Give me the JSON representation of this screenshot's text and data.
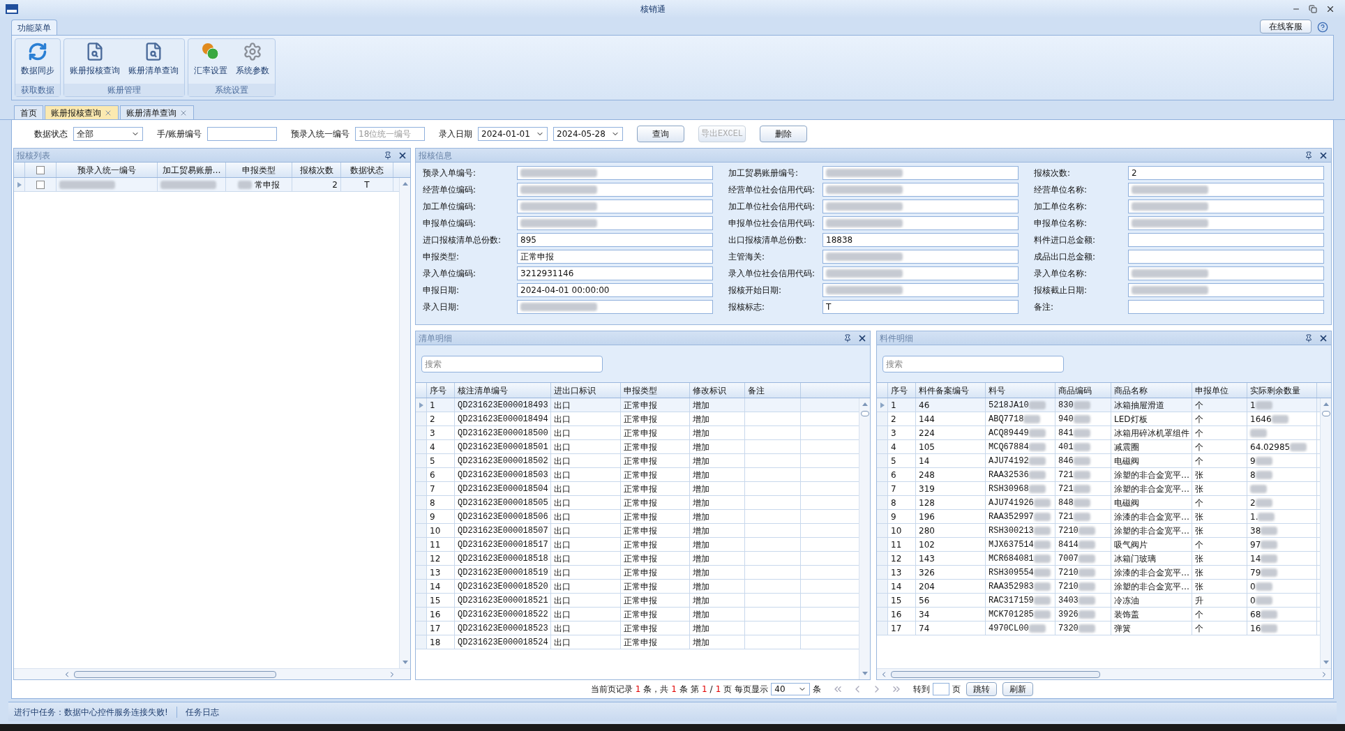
{
  "window": {
    "title": "核销通"
  },
  "ribbon": {
    "tab": "功能菜单",
    "help_button": "在线客服",
    "groups": [
      {
        "label": "获取数据",
        "buttons": [
          {
            "label": "数据同步"
          }
        ]
      },
      {
        "label": "账册管理",
        "buttons": [
          {
            "label": "账册报核查询"
          },
          {
            "label": "账册清单查询"
          }
        ]
      },
      {
        "label": "系统设置",
        "buttons": [
          {
            "label": "汇率设置"
          },
          {
            "label": "系统参数"
          }
        ]
      }
    ]
  },
  "doc_tabs": [
    {
      "label": "首页",
      "selected": false,
      "closable": false
    },
    {
      "label": "账册报核查询",
      "selected": true,
      "closable": true
    },
    {
      "label": "账册清单查询",
      "selected": false,
      "closable": true
    }
  ],
  "filters": [
    {
      "kind": "select",
      "label": "数据状态",
      "value": "全部"
    },
    {
      "kind": "input",
      "label": "手/账册编号"
    },
    {
      "kind": "input",
      "label": "预录入统一编号",
      "placeholder": "18位统一编号"
    },
    {
      "kind": "select",
      "label": "录入日期",
      "value": "2024-01-01"
    },
    {
      "kind": "select",
      "value": "2024-05-28"
    }
  ],
  "filter_buttons": [
    {
      "label": "查询",
      "disabled": false
    },
    {
      "label": "导出EXCEL",
      "disabled": true
    },
    {
      "label": "删除",
      "disabled": false
    }
  ],
  "list_panel": {
    "title": "报核列表",
    "all_checked": false,
    "columns": [
      "预录入统一编号",
      "加工贸易账册…",
      "申报类型",
      "报核次数",
      "数据状态"
    ],
    "rows": [
      {
        "current": true,
        "checked": false,
        "cells": [
          {
            "redacted": true
          },
          {
            "redacted": true
          },
          {
            "text": "常申报",
            "redacted": true
          },
          {
            "text": "2"
          },
          {
            "text": "T"
          }
        ]
      }
    ]
  },
  "info_panel": {
    "title": "报核信息",
    "fields": [
      {
        "label": "预录入单编号:",
        "redacted": true
      },
      {
        "label": "加工贸易账册编号:",
        "redacted": true
      },
      {
        "label": "报核次数:",
        "value": "2"
      },
      {
        "label": "经营单位编码:",
        "redacted": true
      },
      {
        "label": "经营单位社会信用代码:",
        "redacted": true
      },
      {
        "label": "经营单位名称:",
        "redacted": true
      },
      {
        "label": "加工单位编码:",
        "redacted": true
      },
      {
        "label": "加工单位社会信用代码:",
        "redacted": true
      },
      {
        "label": "加工单位名称:",
        "redacted": true
      },
      {
        "label": "申报单位编码:",
        "redacted": true
      },
      {
        "label": "申报单位社会信用代码:",
        "redacted": true
      },
      {
        "label": "申报单位名称:",
        "redacted": true
      },
      {
        "label": "进口报核清单总份数:",
        "value": "895"
      },
      {
        "label": "出口报核清单总份数:",
        "value": "18838"
      },
      {
        "label": "料件进口总金额:"
      },
      {
        "label": "申报类型:",
        "value": "正常申报"
      },
      {
        "label": "主管海关:",
        "redacted": true
      },
      {
        "label": "成品出口总金额:"
      },
      {
        "label": "录入单位编码:",
        "value": "3212931146"
      },
      {
        "label": "录入单位社会信用代码:",
        "redacted": true
      },
      {
        "label": "录入单位名称:",
        "redacted": true
      },
      {
        "label": "申报日期:",
        "value": "2024-04-01 00:00:00"
      },
      {
        "label": "报核开始日期:",
        "redacted": true
      },
      {
        "label": "报核截止日期:",
        "redacted": true
      },
      {
        "label": "录入日期:",
        "redacted": true
      },
      {
        "label": "报核标志:",
        "value": "T"
      },
      {
        "label": "备注:"
      }
    ]
  },
  "list_detail": {
    "title": "清单明细",
    "search_placeholder": "搜索",
    "columns": [
      "序号",
      "核注清单编号",
      "进出口标识",
      "申报类型",
      "修改标识",
      "备注"
    ],
    "rows": [
      {
        "current": true,
        "cells": [
          "1",
          "QD231623E000018493",
          "出口",
          "正常申报",
          "增加"
        ]
      },
      {
        "current": false,
        "cells": [
          "2",
          "QD231623E000018494",
          "出口",
          "正常申报",
          "增加"
        ]
      },
      {
        "current": false,
        "cells": [
          "3",
          "QD231623E000018500",
          "出口",
          "正常申报",
          "增加"
        ]
      },
      {
        "current": false,
        "cells": [
          "4",
          "QD231623E000018501",
          "出口",
          "正常申报",
          "增加"
        ]
      },
      {
        "current": false,
        "cells": [
          "5",
          "QD231623E000018502",
          "出口",
          "正常申报",
          "增加"
        ]
      },
      {
        "current": false,
        "cells": [
          "6",
          "QD231623E000018503",
          "出口",
          "正常申报",
          "增加"
        ]
      },
      {
        "current": false,
        "cells": [
          "7",
          "QD231623E000018504",
          "出口",
          "正常申报",
          "增加"
        ]
      },
      {
        "current": false,
        "cells": [
          "8",
          "QD231623E000018505",
          "出口",
          "正常申报",
          "增加"
        ]
      },
      {
        "current": false,
        "cells": [
          "9",
          "QD231623E000018506",
          "出口",
          "正常申报",
          "增加"
        ]
      },
      {
        "current": false,
        "cells": [
          "10",
          "QD231623E000018507",
          "出口",
          "正常申报",
          "增加"
        ]
      },
      {
        "current": false,
        "cells": [
          "11",
          "QD231623E000018517",
          "出口",
          "正常申报",
          "增加"
        ]
      },
      {
        "current": false,
        "cells": [
          "12",
          "QD231623E000018518",
          "出口",
          "正常申报",
          "增加"
        ]
      },
      {
        "current": false,
        "cells": [
          "13",
          "QD231623E000018519",
          "出口",
          "正常申报",
          "增加"
        ]
      },
      {
        "current": false,
        "cells": [
          "14",
          "QD231623E000018520",
          "出口",
          "正常申报",
          "增加"
        ]
      },
      {
        "current": false,
        "cells": [
          "15",
          "QD231623E000018521",
          "出口",
          "正常申报",
          "增加"
        ]
      },
      {
        "current": false,
        "cells": [
          "16",
          "QD231623E000018522",
          "出口",
          "正常申报",
          "增加"
        ]
      },
      {
        "current": false,
        "cells": [
          "17",
          "QD231623E000018523",
          "出口",
          "正常申报",
          "增加"
        ]
      },
      {
        "current": false,
        "cells": [
          "18",
          "QD231623E000018524",
          "出口",
          "正常申报",
          "增加"
        ]
      }
    ]
  },
  "material_detail": {
    "title": "料件明细",
    "search_placeholder": "搜索",
    "columns": [
      "序号",
      "料件备案编号",
      "料号",
      "商品编码",
      "商品名称",
      "申报单位",
      "实际剩余数量"
    ],
    "rows": [
      {
        "current": true,
        "cells": [
          "1",
          "46",
          {
            "text": "5218JA10",
            "redacted": true
          },
          {
            "text": "830",
            "redacted": true
          },
          "冰箱抽屉滑道",
          "个",
          {
            "text": "1",
            "redacted": true
          }
        ]
      },
      {
        "current": false,
        "cells": [
          "2",
          "144",
          {
            "text": "ABQ7718",
            "redacted": true
          },
          {
            "text": "940",
            "redacted": true
          },
          "LED灯板",
          "个",
          {
            "text": "1646",
            "redacted": true
          }
        ]
      },
      {
        "current": false,
        "cells": [
          "3",
          "224",
          {
            "text": "ACQ89449",
            "redacted": true
          },
          {
            "text": "841",
            "redacted": true
          },
          "冰箱用碎冰机罩组件",
          "个",
          {
            "redacted": true
          }
        ]
      },
      {
        "current": false,
        "cells": [
          "4",
          "105",
          {
            "text": "MCQ67884",
            "redacted": true
          },
          {
            "text": "401",
            "redacted": true
          },
          "减震圈",
          "个",
          {
            "text": "64.02985",
            "redacted": true
          }
        ]
      },
      {
        "current": false,
        "cells": [
          "5",
          "14",
          {
            "text": "AJU74192",
            "redacted": true
          },
          {
            "text": "846",
            "redacted": true
          },
          "电磁阀",
          "个",
          {
            "text": "9",
            "redacted": true
          }
        ]
      },
      {
        "current": false,
        "cells": [
          "6",
          "248",
          {
            "text": "RAA32536",
            "redacted": true
          },
          {
            "text": "721",
            "redacted": true
          },
          "涂塑的非合金宽平…",
          "张",
          {
            "text": "8",
            "redacted": true
          }
        ]
      },
      {
        "current": false,
        "cells": [
          "7",
          "319",
          {
            "text": "RSH30968",
            "redacted": true
          },
          {
            "text": "721",
            "redacted": true
          },
          "涂塑的非合金宽平…",
          "张",
          {
            "redacted": true
          }
        ]
      },
      {
        "current": false,
        "cells": [
          "8",
          "128",
          {
            "text": "AJU741926",
            "redacted": true
          },
          {
            "text": "848",
            "redacted": true
          },
          "电磁阀",
          "个",
          {
            "text": "2",
            "redacted": true
          }
        ]
      },
      {
        "current": false,
        "cells": [
          "9",
          "196",
          {
            "text": "RAA352997",
            "redacted": true
          },
          {
            "text": "721",
            "redacted": true
          },
          "涂漆的非合金宽平…",
          "张",
          {
            "text": "1.",
            "redacted": true
          }
        ]
      },
      {
        "current": false,
        "cells": [
          "10",
          "280",
          {
            "text": "RSH300213",
            "redacted": true
          },
          {
            "text": "7210",
            "redacted": true
          },
          "涂塑的非合金宽平…",
          "张",
          {
            "text": "38",
            "redacted": true
          }
        ]
      },
      {
        "current": false,
        "cells": [
          "11",
          "102",
          {
            "text": "MJX637514",
            "redacted": true
          },
          {
            "text": "8414",
            "redacted": true
          },
          "吸气阀片",
          "个",
          {
            "text": "97",
            "redacted": true
          }
        ]
      },
      {
        "current": false,
        "cells": [
          "12",
          "143",
          {
            "text": "MCR684081",
            "redacted": true
          },
          {
            "text": "7007",
            "redacted": true
          },
          "冰箱门玻璃",
          "张",
          {
            "text": "14",
            "redacted": true
          }
        ]
      },
      {
        "current": false,
        "cells": [
          "13",
          "326",
          {
            "text": "RSH309554",
            "redacted": true
          },
          {
            "text": "7210",
            "redacted": true
          },
          "涂漆的非合金宽平…",
          "张",
          {
            "text": "79",
            "redacted": true
          }
        ]
      },
      {
        "current": false,
        "cells": [
          "14",
          "204",
          {
            "text": "RAA352983",
            "redacted": true
          },
          {
            "text": "7210",
            "redacted": true
          },
          "涂塑的非合金宽平…",
          "张",
          {
            "text": "0",
            "redacted": true
          }
        ]
      },
      {
        "current": false,
        "cells": [
          "15",
          "56",
          {
            "text": "RAC317159",
            "redacted": true
          },
          {
            "text": "3403",
            "redacted": true
          },
          "冷冻油",
          "升",
          {
            "text": "0",
            "redacted": true
          }
        ]
      },
      {
        "current": false,
        "cells": [
          "16",
          "34",
          {
            "text": "MCK701285",
            "redacted": true
          },
          {
            "text": "3926",
            "redacted": true
          },
          "装饰盖",
          "个",
          {
            "text": "68",
            "redacted": true
          }
        ]
      },
      {
        "current": false,
        "cells": [
          "17",
          "74",
          {
            "text": "4970CL00",
            "redacted": true
          },
          {
            "text": "7320",
            "redacted": true
          },
          "弹簧",
          "个",
          {
            "text": "16",
            "redacted": true
          }
        ]
      }
    ]
  },
  "pager": {
    "segments": [
      {
        "text": "当前页记录",
        "highlight": false
      },
      {
        "text": "1",
        "highlight": true
      },
      {
        "text": "条，共",
        "highlight": false
      },
      {
        "text": "1",
        "highlight": true
      },
      {
        "text": "条",
        "highlight": false
      },
      {
        "text": "第",
        "highlight": false
      },
      {
        "text": "1",
        "highlight": true
      },
      {
        "text": "/",
        "highlight": false
      },
      {
        "text": "1",
        "highlight": true
      },
      {
        "text": "页",
        "highlight": false
      },
      {
        "text": "每页显示",
        "highlight": false
      }
    ],
    "page_size": "40",
    "page_size_unit": "条",
    "goto_label": "转到",
    "goto_unit": "页",
    "goto_button": "跳转",
    "refresh_button": "刷新"
  },
  "status_bar": {
    "task": "进行中任务：数据中心控件服务连接失败!",
    "log": "任务日志"
  }
}
